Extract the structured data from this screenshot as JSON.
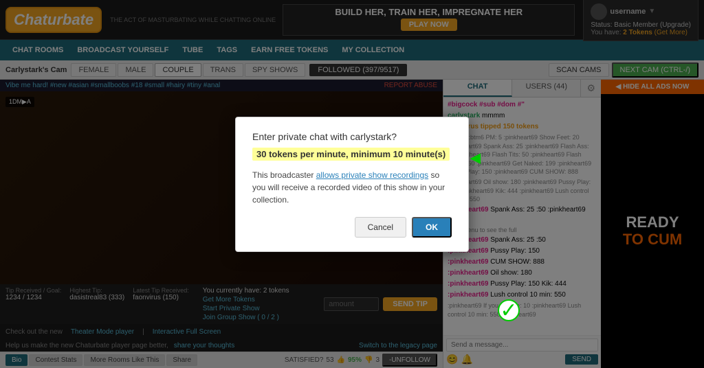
{
  "header": {
    "logo": "Chaturbate",
    "tagline": "THE ACT OF MASTURBATING WHILE CHATTING ONLINE",
    "banner": {
      "text": "BUILD HER, TRAIN HER, IMPREGNATE HER",
      "cta": "PLAY NOW"
    },
    "user": {
      "name": "username",
      "status_label": "Status:",
      "status_value": "Basic Member",
      "upgrade_label": "(Upgrade)",
      "tokens_label": "You have:",
      "tokens_value": "2 Tokens",
      "get_more_label": "(Get More)"
    }
  },
  "nav": {
    "items": [
      {
        "label": "CHAT ROOMS"
      },
      {
        "label": "BROADCAST YOURSELF"
      },
      {
        "label": "TUBE"
      },
      {
        "label": "TAGS"
      },
      {
        "label": "EARN FREE TOKENS"
      },
      {
        "label": "MY COLLECTION"
      }
    ]
  },
  "sub_nav": {
    "cam_label": "Carlystark's Cam",
    "tabs": [
      {
        "label": "FEMALE"
      },
      {
        "label": "MALE"
      },
      {
        "label": "COUPLE",
        "active": true
      },
      {
        "label": "TRANS"
      },
      {
        "label": "SPY SHOWS"
      }
    ],
    "followed": "FOLLOWED (397/9517)",
    "scan_cams": "SCAN CAMS",
    "next_cam": "NEXT CAM (CTRL-/)"
  },
  "video": {
    "bio": "Vibe me hard! #new #asian #smallboobs #18 #small #hairy #tiny #anal",
    "report": "REPORT ABUSE",
    "badge": "1DM▶A",
    "tip_received_label": "Tip Received / Goal:",
    "tip_received_value": "1234 / 1234",
    "highest_tip_label": "Highest Tip:",
    "highest_tip_value": "dasistreal83 (333)",
    "latest_tip_label": "Latest Tip Received:",
    "latest_tip_value": "faonvirus (150)",
    "tokens_label": "You currently have: 2 tokens",
    "get_more": "Get More Tokens",
    "start_private": "Start Private Show",
    "join_group": "Join Group Show ( 0 / 2 )",
    "send_tip": "SEND TIP",
    "bottom_text1": "Check out the new",
    "theater_link": "Theater Mode player",
    "separator": "|",
    "interactive_link": "Interactive Full Screen",
    "feedback": "Help us make the new Chaturbate player page better,",
    "share_thoughts": "share your thoughts",
    "legacy_link": "Switch to the legacy page"
  },
  "bio_tabs": {
    "tabs": [
      {
        "label": "Bio",
        "active": true
      },
      {
        "label": "Contest Stats"
      },
      {
        "label": "More Rooms Like This"
      },
      {
        "label": "Share"
      }
    ],
    "satisfied": "SATISFIED?",
    "percent": "95%",
    "thumbs_up": "👍",
    "count": "53",
    "dislike_count": "3",
    "unfollow": "-UNFOLLOW"
  },
  "chat": {
    "tabs": [
      {
        "label": "CHAT",
        "active": true
      },
      {
        "label": "USERS (44)"
      },
      {
        "label": "⚙"
      }
    ],
    "messages": [
      {
        "user": "#bigcock #sub #dom #\"",
        "color": "pink",
        "text": ""
      },
      {
        "user": "carlystark",
        "color": "green",
        "text": "mmmm"
      },
      {
        "user": "faonvirus",
        "color": "orange",
        "tipped": "tipped 150 tokens"
      },
      {
        "type": "notice",
        "text": "Notice: :btm6 PM: 5 :pinkheart69 Show Feet: 20 :pinkheart69 Spank Ass: 25 :pinkheart69 Flash Ass: 35 :pinkheart69 Flash Tits: 50 :pinkheart69 Flash Pussy: 60 :pinkheart69 Get Naked: 199 :pinkheart69 Pussy Play: 150 :pinkheart69 CUM SHOW: 888"
      },
      {
        "type": "notice",
        "text": ":pinkheart69 Oil show: 180 :pinkheart69 Pussy Play: 150 :pinkheart69 Kik: 444 :pinkheart69 Lush control 10 min: 550"
      },
      {
        "user": "pinkheart69",
        "color": "pink",
        "text": "Spank Ass: 25 :pinkheart69 Flash Ass: 50 :pinkheart69 Flash Pussy: 150"
      },
      {
        "type": "notice",
        "text": "type /menu to see the full"
      },
      {
        "user": "pinkheart69",
        "color": "pink",
        "text": "Spank Ass: 25 :50 :pinkheart69 Flash"
      },
      {
        "user": "pinkheart69",
        "color": "pink",
        "text": "Pussy Play: 150"
      },
      {
        "user": "pinkheart69",
        "color": "pink",
        "text": "CUM SHOW: 888"
      },
      {
        "user": "pinkheart69",
        "color": "pink",
        "text": "Oil show: 180"
      },
      {
        "user": "pinkheart69",
        "color": "pink",
        "text": "Pussy Play: 150 :pinkheart69 Kik: 444"
      },
      {
        "user": "pinkheart69",
        "color": "pink",
        "text": "Lush control 10 min: 550"
      },
      {
        "type": "notice",
        "text": ":pinkheart69 If you like me: 10 :pinkheart69 Lush control 10 min: 550 :pinkheart69"
      }
    ],
    "send_placeholder": "Send a message...",
    "send_label": "SEND"
  },
  "ads": {
    "hide_label": "◀ HIDE ALL ADS NOW",
    "ready_line1": "READY",
    "ready_line2": "TO CUM"
  },
  "modal": {
    "title": "Enter private chat with carlystark?",
    "highlight": "30 tokens per minute, minimum 10 minute(s)",
    "body1": "This broadcaster",
    "body_link": "allows private show recordings",
    "body2": "so you will receive a recorded video of this show in your collection.",
    "cancel": "Cancel",
    "ok": "OK"
  }
}
